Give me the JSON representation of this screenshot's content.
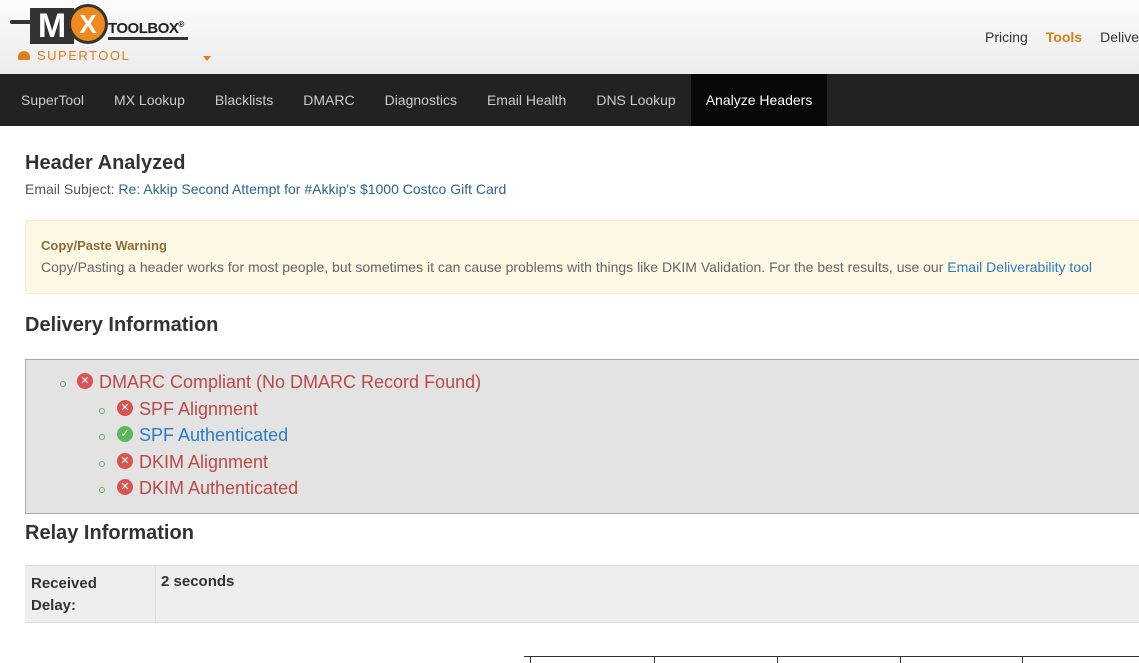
{
  "logo": {
    "brand_m": "M",
    "brand_x": "X",
    "brand_toolbox": "TOOLBOX",
    "registered": "®",
    "product": "SUPERTOOL"
  },
  "toplinks": [
    {
      "label": "Pricing",
      "active": false
    },
    {
      "label": "Tools",
      "active": true
    },
    {
      "label": "Delive",
      "active": false
    }
  ],
  "nav": [
    {
      "label": "SuperTool",
      "active": false
    },
    {
      "label": "MX Lookup",
      "active": false
    },
    {
      "label": "Blacklists",
      "active": false
    },
    {
      "label": "DMARC",
      "active": false
    },
    {
      "label": "Diagnostics",
      "active": false
    },
    {
      "label": "Email Health",
      "active": false
    },
    {
      "label": "DNS Lookup",
      "active": false
    },
    {
      "label": "Analyze Headers",
      "active": true
    }
  ],
  "header": {
    "title": "Header Analyzed",
    "subject_label": "Email Subject:",
    "subject_value": "Re: Akkip Second Attempt for #Akkip's $1000 Costco Gift Card"
  },
  "warning": {
    "title": "Copy/Paste Warning",
    "text": "Copy/Pasting a header works for most people, but sometimes it can cause problems with things like DKIM Validation. For the best results, use our",
    "link": "Email Deliverability tool"
  },
  "delivery": {
    "title": "Delivery Information",
    "items": [
      {
        "label": "DMARC Compliant (No DMARC Record Found)",
        "status": "fail",
        "icon": "times-circle-icon"
      },
      {
        "label": "SPF Alignment",
        "status": "fail",
        "icon": "times-circle-icon"
      },
      {
        "label": "SPF Authenticated",
        "status": "pass",
        "icon": "check-circle-icon"
      },
      {
        "label": "DKIM Alignment",
        "status": "fail",
        "icon": "times-circle-icon"
      },
      {
        "label": "DKIM Authenticated",
        "status": "fail",
        "icon": "times-circle-icon"
      }
    ]
  },
  "relay": {
    "title": "Relay Information",
    "delay_label": "Received Delay:",
    "delay_value": "2 seconds"
  },
  "colors": {
    "accent": "#e07d1c",
    "fail": "#b94a48",
    "pass": "#2a7cc0",
    "nav_bg": "#222222"
  }
}
